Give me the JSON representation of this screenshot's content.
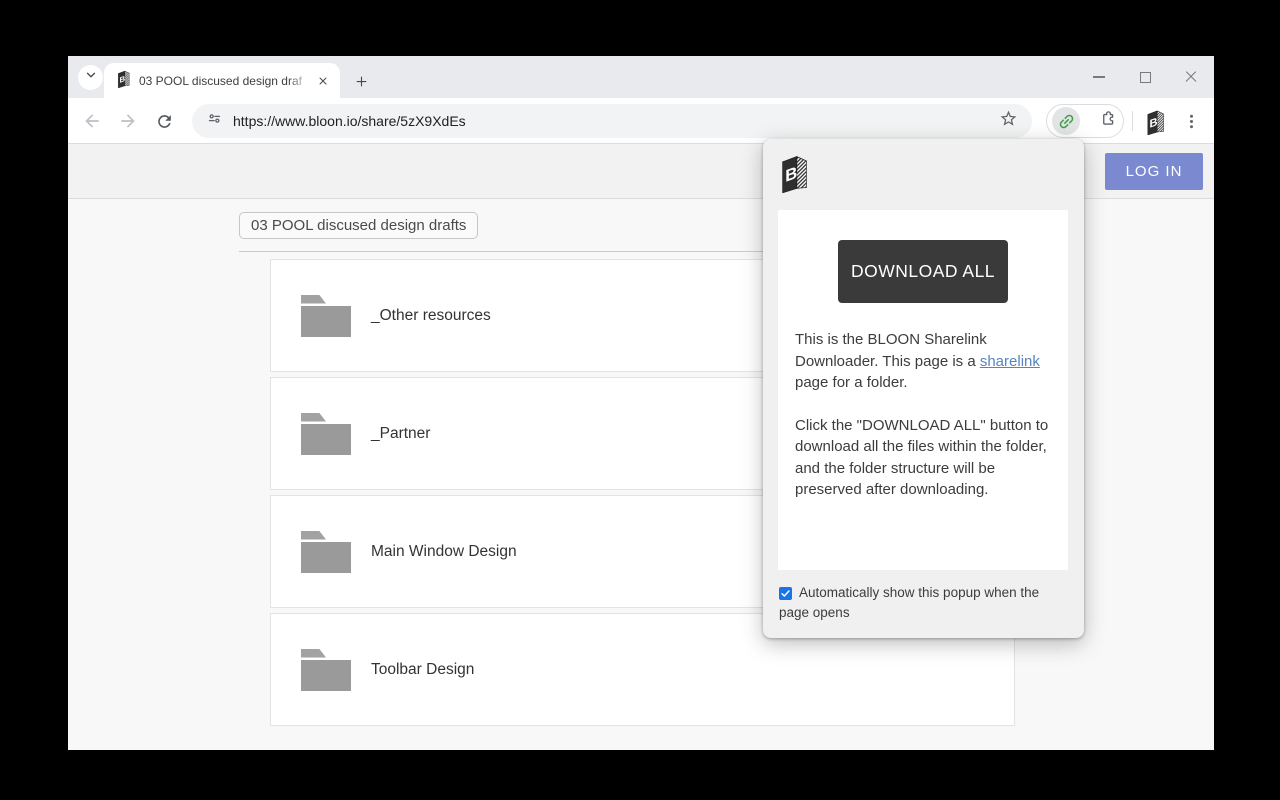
{
  "browser": {
    "tab": {
      "title": "03 POOL discused design draf"
    },
    "url": "https://www.bloon.io/share/5zX9XdEs",
    "icons": {
      "tab_search": "chevron-down",
      "favicon": "bloon-book-logo",
      "new_tab": "plus",
      "window": [
        "minimize",
        "maximize",
        "close"
      ],
      "nav": [
        "arrow-back",
        "arrow-forward",
        "reload"
      ],
      "omnibox_left": "site-settings-tune",
      "omnibox_right": "bookmark-star-outline",
      "extension_active": "green-link",
      "extensions_menu": "puzzle-piece",
      "profile": "bloon-book-logo",
      "menu": "three-dots-vertical"
    }
  },
  "page": {
    "login_label": "LOG IN",
    "breadcrumb": "03 POOL discused design drafts",
    "folders": [
      {
        "name": "_Other resources"
      },
      {
        "name": "_Partner"
      },
      {
        "name": "Main Window Design"
      },
      {
        "name": "Toolbar Design"
      }
    ]
  },
  "popup": {
    "logo": "bloon-book-logo",
    "download_all_label": "DOWNLOAD ALL",
    "para1_pre": "This is the BLOON Sharelink Downloader. This page is a ",
    "para1_link": "sharelink",
    "para1_post": " page for a folder.",
    "para2": "Click the \"DOWNLOAD ALL\" button to download all the files within the folder, and the folder structure will be preserved after downloading.",
    "checkbox_checked": true,
    "checkbox_label": "Automatically show this popup when the page opens"
  },
  "colors": {
    "login_button": "#7a89d0",
    "download_button": "#3a3a3a",
    "sharelink_link": "#5585c0",
    "checkbox": "#1a73e8",
    "extension_link_green": "#43a047",
    "folder_icon": "#9a9a9a",
    "tabstrip_bg": "#e8eaed",
    "popup_bg": "#f0f0f0"
  }
}
